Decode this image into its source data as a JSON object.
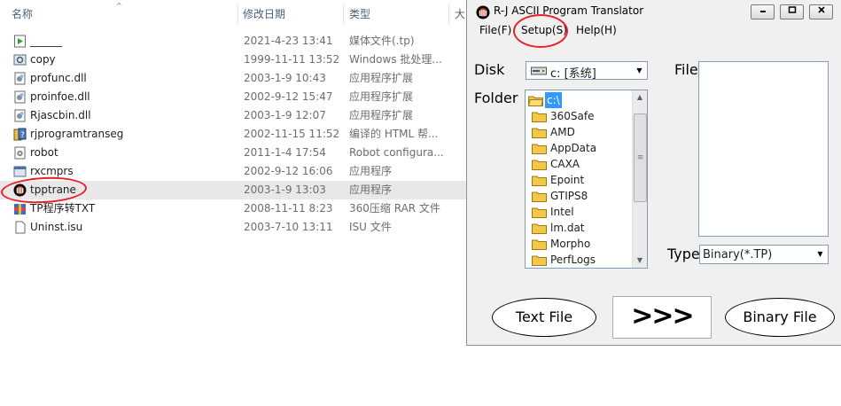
{
  "explorer": {
    "columns": {
      "name": "名称",
      "date": "修改日期",
      "type": "类型",
      "size": "大"
    },
    "files": [
      {
        "name": "______",
        "date": "2021-4-23 13:41",
        "type": "媒体文件(.tp)",
        "icon": "media-file-icon"
      },
      {
        "name": "copy",
        "date": "1999-11-11 13:52",
        "type": "Windows 批处理...",
        "icon": "batch-file-icon"
      },
      {
        "name": "profunc.dll",
        "date": "2003-1-9 10:43",
        "type": "应用程序扩展",
        "icon": "dll-icon"
      },
      {
        "name": "proinfoe.dll",
        "date": "2002-9-12 15:47",
        "type": "应用程序扩展",
        "icon": "dll-icon"
      },
      {
        "name": "Rjascbin.dll",
        "date": "2003-1-9 12:07",
        "type": "应用程序扩展",
        "icon": "dll-icon"
      },
      {
        "name": "rjprogramtranseg",
        "date": "2002-11-15 11:52",
        "type": "编译的 HTML 帮...",
        "icon": "chm-help-icon"
      },
      {
        "name": "robot",
        "date": "2011-1-4 17:54",
        "type": "Robot configura...",
        "icon": "config-file-icon"
      },
      {
        "name": "rxcmprs",
        "date": "2002-9-12 16:06",
        "type": "应用程序",
        "icon": "exe-icon"
      },
      {
        "name": "tpptrane",
        "date": "2003-1-9 13:03",
        "type": "应用程序",
        "icon": "tp-app-icon"
      },
      {
        "name": "TP程序转TXT",
        "date": "2008-11-11 8:23",
        "type": "360压缩 RAR 文件",
        "icon": "rar-archive-icon"
      },
      {
        "name": "Uninst.isu",
        "date": "2003-7-10 13:11",
        "type": "ISU 文件",
        "icon": "blank-file-icon"
      }
    ],
    "selected_index": 8
  },
  "app": {
    "title": "R-J ASCII Program Translator",
    "menu": [
      "File(F)",
      "Setup(S)",
      "Help(H)"
    ],
    "disk_label": "Disk",
    "disk_value": "c: [系统]",
    "folder_label": "Folder",
    "folders": [
      "c:\\",
      "360Safe",
      "AMD",
      "AppData",
      "CAXA",
      "Epoint",
      "GTIPS8",
      "Intel",
      "lm.dat",
      "Morpho",
      "PerfLogs"
    ],
    "file_label": "File",
    "type_label": "Type",
    "type_value": "Binary(*.TP)",
    "text_file_button": "Text File",
    "convert_button": ">>>",
    "binary_file_button": "Binary File"
  },
  "colors": {
    "annotation": "#e8202a",
    "selection": "#3399ff",
    "folder": "#f2c84b"
  }
}
